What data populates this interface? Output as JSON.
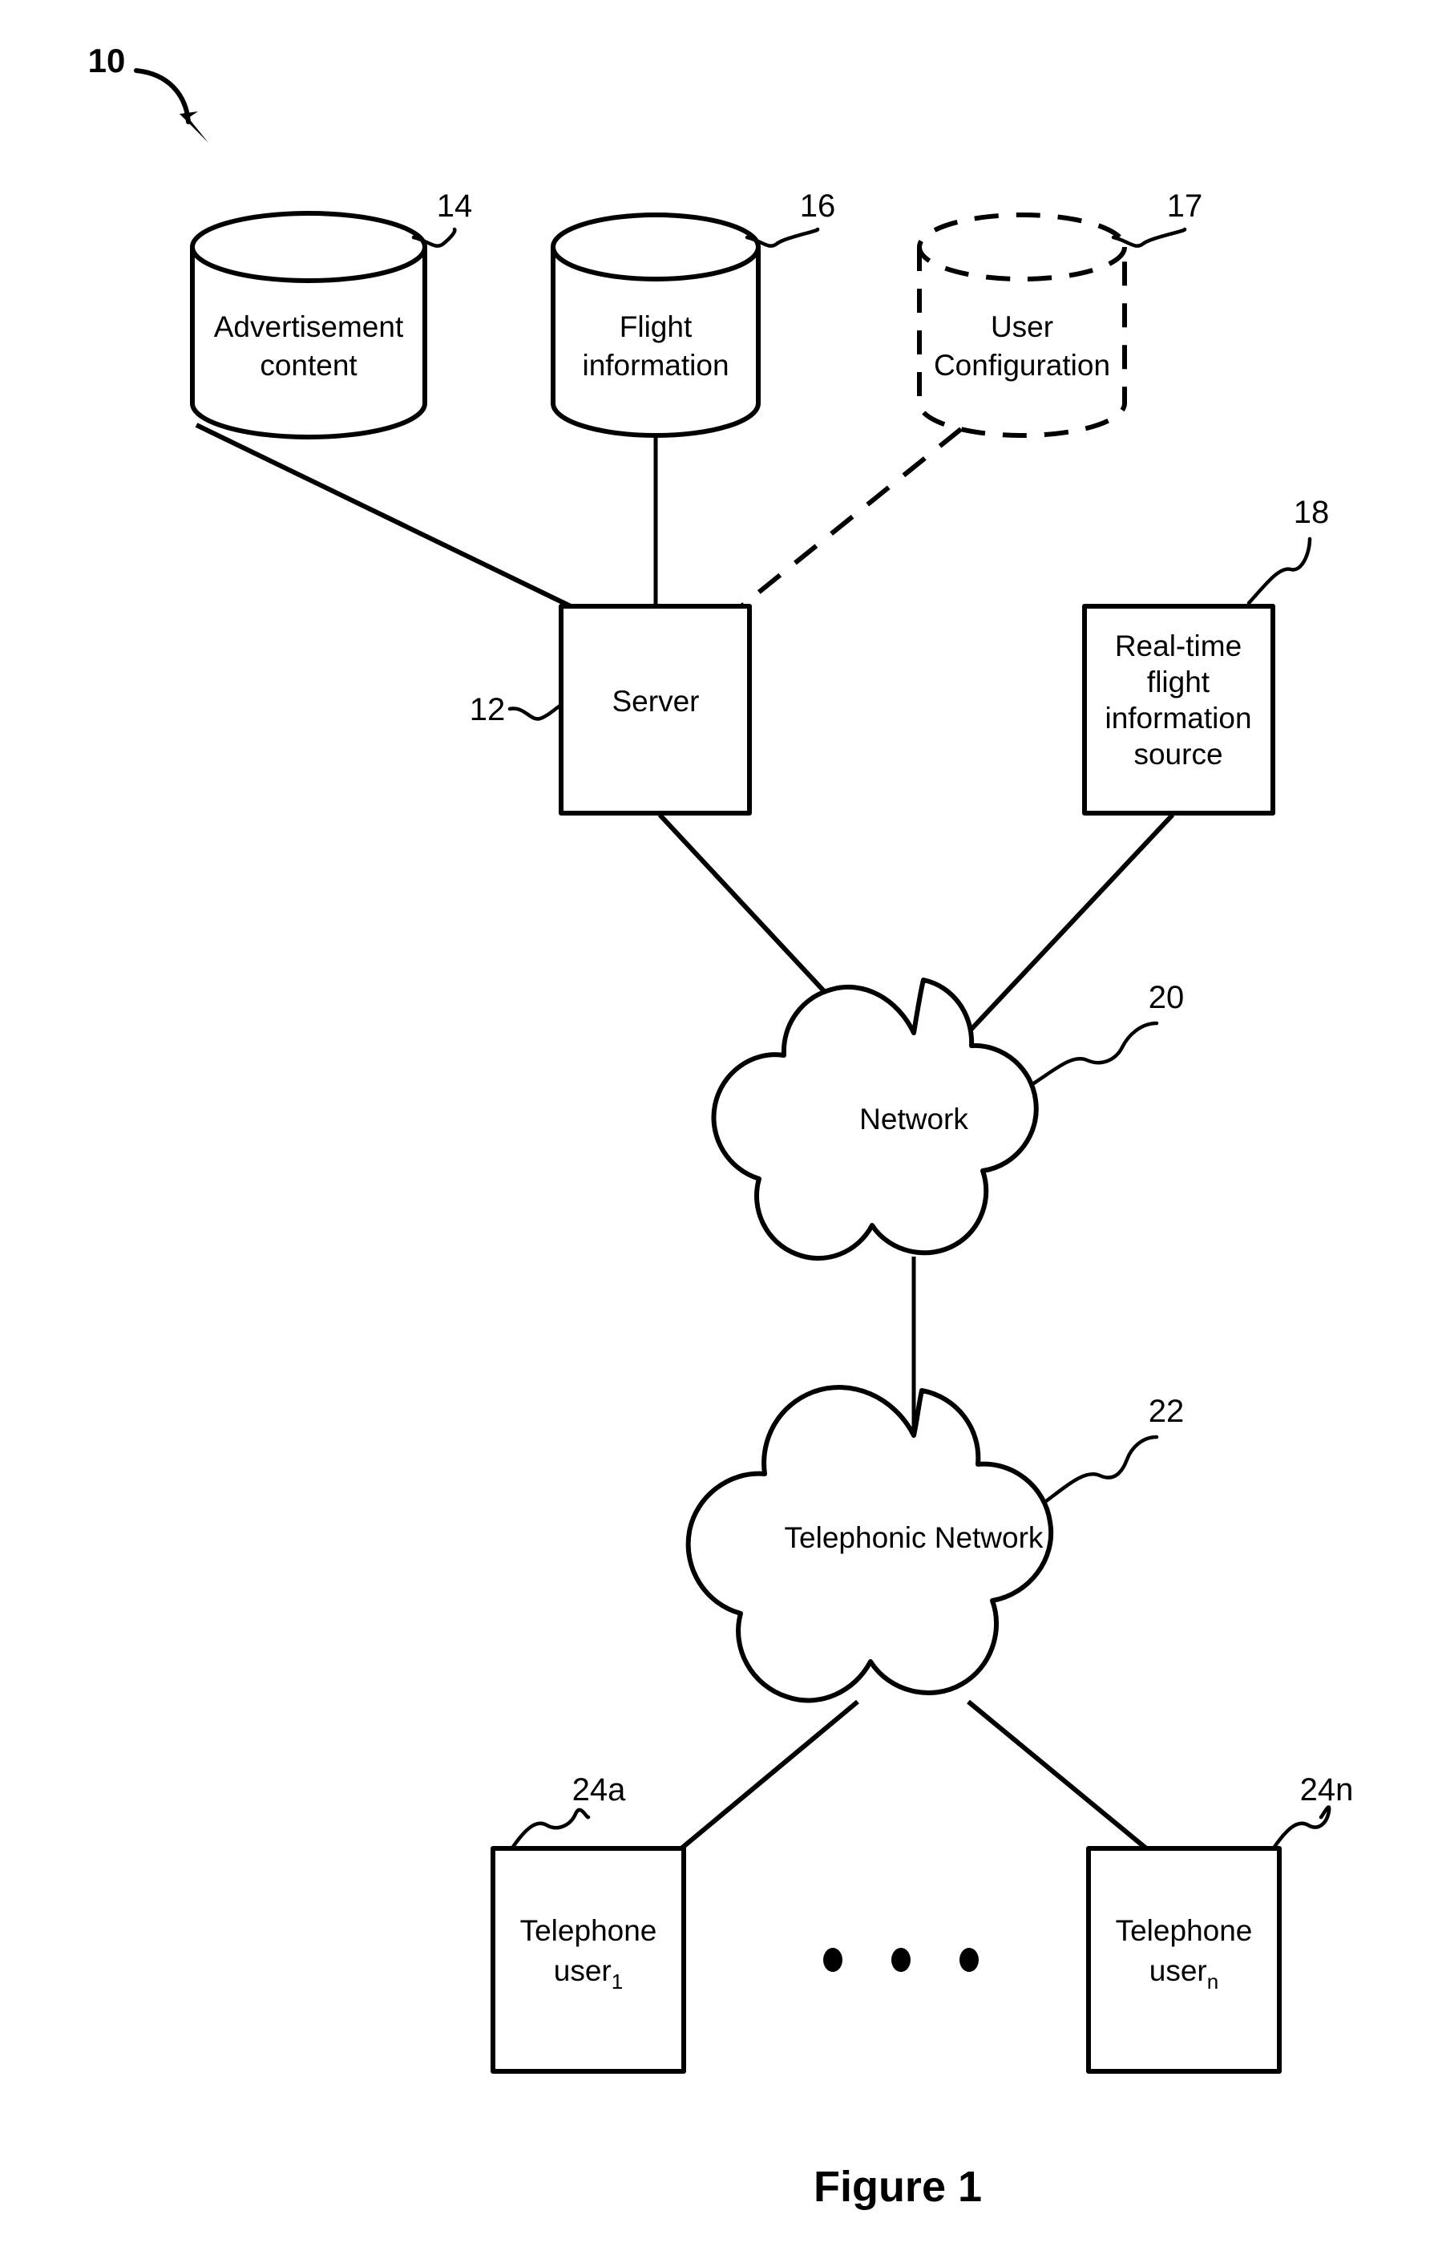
{
  "figure": {
    "caption": "Figure 1",
    "system_ref": "10"
  },
  "nodes": {
    "advertisement_content": {
      "label_line1": "Advertisement",
      "label_line2": "content",
      "ref": "14",
      "shape": "cylinder",
      "style": "solid"
    },
    "flight_information": {
      "label_line1": "Flight",
      "label_line2": "information",
      "ref": "16",
      "shape": "cylinder",
      "style": "solid"
    },
    "user_configuration": {
      "label_line1": "User",
      "label_line2": "Configuration",
      "ref": "17",
      "shape": "cylinder",
      "style": "dashed"
    },
    "server": {
      "label_line1": "Server",
      "ref": "12",
      "shape": "rectangle",
      "style": "solid"
    },
    "realtime_flight_source": {
      "label_line1": "Real-time",
      "label_line2": "flight",
      "label_line3": "information",
      "label_line4": "source",
      "ref": "18",
      "shape": "rectangle",
      "style": "solid"
    },
    "network": {
      "label_line1": "Network",
      "ref": "20",
      "shape": "cloud",
      "style": "solid"
    },
    "telephonic_network": {
      "label_line1": "Telephonic Network",
      "ref": "22",
      "shape": "cloud",
      "style": "solid"
    },
    "telephone_user_first": {
      "label_line1": "Telephone",
      "label_line2": "user",
      "label_subscript": "1",
      "ref": "24a",
      "shape": "rectangle",
      "style": "solid"
    },
    "telephone_user_last": {
      "label_line1": "Telephone",
      "label_line2": "user",
      "label_subscript": "n",
      "ref": "24n",
      "shape": "rectangle",
      "style": "solid"
    }
  },
  "connections": [
    {
      "from": "advertisement_content",
      "to": "server",
      "style": "solid"
    },
    {
      "from": "flight_information",
      "to": "server",
      "style": "solid"
    },
    {
      "from": "user_configuration",
      "to": "server",
      "style": "dashed"
    },
    {
      "from": "server",
      "to": "network",
      "style": "solid"
    },
    {
      "from": "realtime_flight_source",
      "to": "network",
      "style": "solid"
    },
    {
      "from": "network",
      "to": "telephonic_network",
      "style": "solid"
    },
    {
      "from": "telephonic_network",
      "to": "telephone_user_first",
      "style": "solid"
    },
    {
      "from": "telephonic_network",
      "to": "telephone_user_last",
      "style": "solid"
    }
  ],
  "colors": {
    "ink": "#000000",
    "paper": "#ffffff"
  }
}
